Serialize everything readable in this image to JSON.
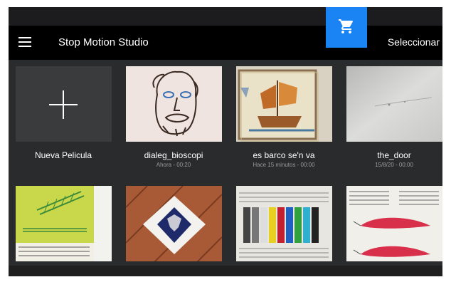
{
  "app": {
    "title": "Stop Motion Studio",
    "select_label": "Seleccionar",
    "accent_color": "#1a84f4"
  },
  "icons": {
    "menu": "hamburger-menu-icon",
    "store": "shopping-cart-icon",
    "new": "plus-icon"
  },
  "projects": [
    {
      "name": "Nueva Pelicula",
      "meta": "",
      "thumbnail": "new-movie-plus"
    },
    {
      "name": "dialeg_bioscopi",
      "meta": "Ahora - 00:20",
      "thumbnail": "face-drawing"
    },
    {
      "name": "es barco se'n va",
      "meta": "Hace 15 minutos - 00:00",
      "thumbnail": "ship-tile"
    },
    {
      "name": "the_door",
      "meta": "15/8/20 - 00:00",
      "thumbnail": "white-wall"
    },
    {
      "name": "",
      "meta": "",
      "thumbnail": "green-book-page"
    },
    {
      "name": "",
      "meta": "",
      "thumbnail": "eagle-tile"
    },
    {
      "name": "",
      "meta": "",
      "thumbnail": "color-bars-page"
    },
    {
      "name": "",
      "meta": "",
      "thumbnail": "airfoil-diagram-page"
    }
  ]
}
